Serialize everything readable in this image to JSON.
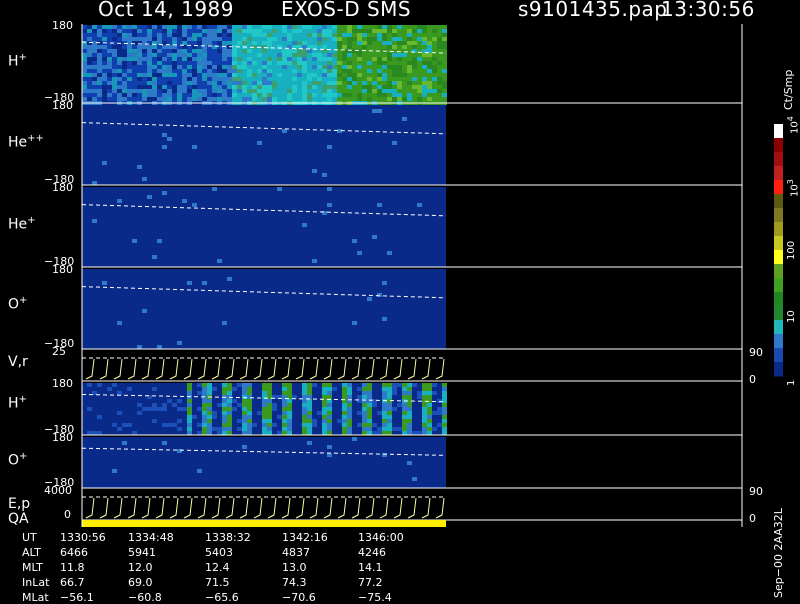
{
  "header": {
    "date": "Oct 14, 1989",
    "instrument": "EXOS-D SMS",
    "file": "s9101435.pap",
    "time": "13:30:56"
  },
  "colors": {
    "spectrum_bg": "#0a2a8a",
    "frame": "#ffffff",
    "marker_line": "#ffffff",
    "qa_bar": "#ffee00"
  },
  "chart_data": {
    "type": "heatmap",
    "panels": [
      {
        "id": "h_plus_1",
        "label": "H",
        "sup": "+",
        "y_top": "180",
        "y_bottom": "−180",
        "intensity": "high"
      },
      {
        "id": "he_pp",
        "label": "He",
        "sup": "++",
        "y_top": "180",
        "y_bottom": "−180",
        "intensity": "low"
      },
      {
        "id": "he_plus",
        "label": "He",
        "sup": "+",
        "y_top": "180",
        "y_bottom": "−180",
        "intensity": "low"
      },
      {
        "id": "o_plus_1",
        "label": "O",
        "sup": "+",
        "y_top": "180",
        "y_bottom": "−180",
        "intensity": "low"
      },
      {
        "id": "vr",
        "label": "V,r",
        "sup": "",
        "y_top": "25",
        "y_bottom": "",
        "right_top": "90",
        "right_bottom": "0",
        "kind": "line"
      },
      {
        "id": "h_plus_2",
        "label": "H",
        "sup": "+",
        "y_top": "180",
        "y_bottom": "−180",
        "intensity": "striped"
      },
      {
        "id": "o_plus_2",
        "label": "O",
        "sup": "+",
        "y_top": "180",
        "y_bottom": "−180",
        "intensity": "low"
      },
      {
        "id": "ep",
        "label": "E,p",
        "sup": "",
        "y_top": "4000",
        "y_bottom": "0",
        "right_top": "90",
        "right_bottom": "0",
        "kind": "line"
      },
      {
        "id": "qa",
        "label": "QA",
        "sup": "",
        "kind": "bar"
      }
    ],
    "colorbar": {
      "unit": "Ct/Smp",
      "ticks": [
        {
          "base": "10",
          "exp": "4",
          "value": 10000
        },
        {
          "base": "10",
          "exp": "3",
          "value": 1000
        },
        {
          "base": "100",
          "exp": "",
          "value": 100
        },
        {
          "base": "10",
          "exp": "",
          "value": 10
        },
        {
          "base": "1",
          "exp": "",
          "value": 1
        }
      ],
      "scale": "log"
    },
    "ephemeris": {
      "rows": [
        {
          "label": "UT",
          "values": [
            "1330:56",
            "1334:48",
            "1338:32",
            "1342:16",
            "1346:00"
          ]
        },
        {
          "label": "ALT",
          "values": [
            "6466",
            "5941",
            "5403",
            "4837",
            "4246"
          ]
        },
        {
          "label": "MLT",
          "values": [
            "11.8",
            "12.0",
            "12.4",
            "13.0",
            "14.1"
          ]
        },
        {
          "label": "InLat",
          "values": [
            "66.7",
            "69.0",
            "71.5",
            "74.3",
            "77.2"
          ]
        },
        {
          "label": "MLat",
          "values": [
            "−56.1",
            "−60.8",
            "−65.6",
            "−70.6",
            "−75.4"
          ]
        }
      ]
    },
    "footer_vertical": "Sep−00  2AA32L"
  }
}
